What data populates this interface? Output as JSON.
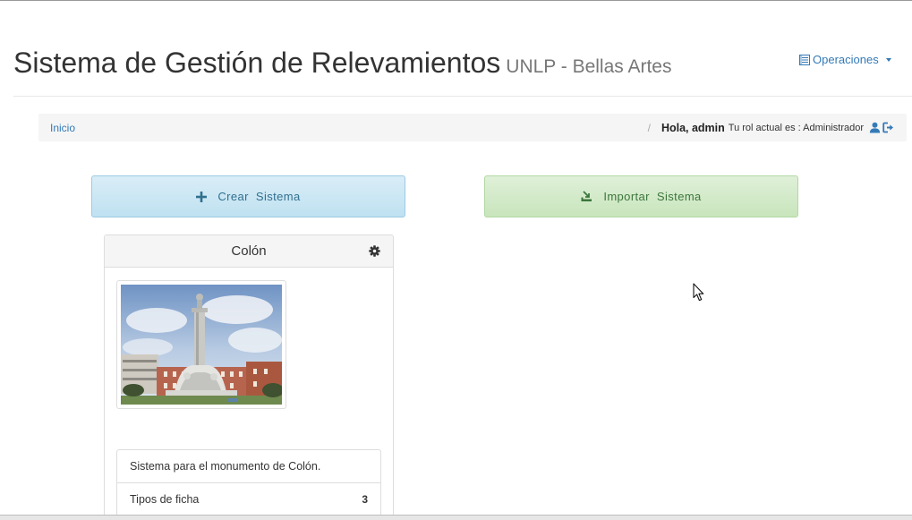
{
  "header": {
    "title": "Sistema de Gestión de Relevamientos",
    "subtitle": "UNLP - Bellas Artes",
    "operations_menu": {
      "label": "Operaciones",
      "icon": "list-icon"
    }
  },
  "breadcrumb": {
    "home": "Inicio",
    "separator": "/",
    "greeting": "Hola, admin",
    "role_text": "Tu rol actual es : Administrador",
    "icons": [
      "user-icon",
      "logout-icon"
    ]
  },
  "actions": {
    "create": {
      "word1": "Crear",
      "word2": "Sistema",
      "icon": "plus-icon"
    },
    "import": {
      "word1": "Importar",
      "word2": "Sistema",
      "icon": "import-icon"
    }
  },
  "system_card": {
    "title": "Colón",
    "image_alt": "Monumento a Colón",
    "description": "Sistema para el monumento de Colón.",
    "stats": [
      {
        "label": "Tipos de ficha",
        "value": "3"
      }
    ]
  },
  "colors": {
    "link": "#337ab7",
    "info_text": "#31708f",
    "info_bg": "#d9edf7",
    "success_text": "#3c763d",
    "success_bg": "#dff0d8",
    "heading_bg": "#f5f5f5"
  }
}
